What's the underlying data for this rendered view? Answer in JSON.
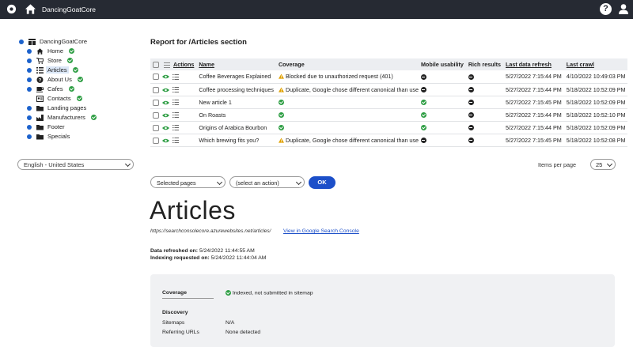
{
  "topbar": {
    "site_name": "DancingGoatCore",
    "help_label": "?"
  },
  "tree": [
    {
      "label": "DancingGoatCore",
      "icon": "site-tree-icon",
      "ok": false,
      "selected": false,
      "level": 0
    },
    {
      "label": "Home",
      "icon": "home-icon",
      "ok": true,
      "selected": false,
      "level": 1
    },
    {
      "label": "Store",
      "icon": "cart-icon",
      "ok": true,
      "selected": false,
      "level": 1
    },
    {
      "label": "Articles",
      "icon": "list-icon",
      "ok": true,
      "selected": true,
      "level": 1
    },
    {
      "label": "About Us",
      "icon": "question-icon",
      "ok": true,
      "selected": false,
      "level": 1
    },
    {
      "label": "Cafes",
      "icon": "cup-icon",
      "ok": true,
      "selected": false,
      "level": 1
    },
    {
      "label": "Contacts",
      "icon": "contacts-icon",
      "ok": true,
      "selected": false,
      "level": 1
    },
    {
      "label": "Landing pages",
      "icon": "folder-icon",
      "ok": false,
      "selected": false,
      "level": 1
    },
    {
      "label": "Manufacturers",
      "icon": "factory-icon",
      "ok": true,
      "selected": false,
      "level": 1
    },
    {
      "label": "Footer",
      "icon": "folder-icon",
      "ok": false,
      "selected": false,
      "level": 1
    },
    {
      "label": "Specials",
      "icon": "folder-icon",
      "ok": false,
      "selected": false,
      "level": 1
    }
  ],
  "language": "English - United States",
  "report": {
    "title": "Report for /Articles section",
    "headers": {
      "actions": "Actions",
      "name": "Name",
      "coverage": "Coverage",
      "mobile": "Mobile usability",
      "rich": "Rich results",
      "refresh": "Last data refresh",
      "crawl": "Last crawl"
    },
    "rows": [
      {
        "name": "Coffee Beverages Explained",
        "coverage": "Blocked due to unauthorized request (401)",
        "coverage_status": "warn",
        "mobile": "blocked",
        "rich": "blocked",
        "refresh": "5/27/2022 7:15:44 PM",
        "crawl": "4/10/2022 10:49:03 PM"
      },
      {
        "name": "Coffee processing techniques",
        "coverage": "Duplicate, Google chose different canonical than user",
        "coverage_status": "warn",
        "mobile": "blocked",
        "rich": "blocked",
        "refresh": "5/27/2022 7:15:44 PM",
        "crawl": "5/18/2022 10:52:09 PM"
      },
      {
        "name": "New article 1",
        "coverage": "",
        "coverage_status": "ok",
        "mobile": "ok",
        "rich": "blocked",
        "refresh": "5/27/2022 7:15:45 PM",
        "crawl": "5/18/2022 10:52:09 PM"
      },
      {
        "name": "On Roasts",
        "coverage": "",
        "coverage_status": "ok",
        "mobile": "ok",
        "rich": "blocked",
        "refresh": "5/27/2022 7:15:44 PM",
        "crawl": "5/18/2022 10:52:10 PM"
      },
      {
        "name": "Origins of Arabica Bourbon",
        "coverage": "",
        "coverage_status": "ok",
        "mobile": "ok",
        "rich": "blocked",
        "refresh": "5/27/2022 7:15:44 PM",
        "crawl": "5/18/2022 10:52:09 PM"
      },
      {
        "name": "Which brewing fits you?",
        "coverage": "Duplicate, Google chose different canonical than user",
        "coverage_status": "warn",
        "mobile": "blocked",
        "rich": "blocked",
        "refresh": "5/27/2022 7:15:45 PM",
        "crawl": "5/18/2022 10:52:08 PM"
      }
    ],
    "items_per_page_label": "Items per page",
    "items_per_page": "25"
  },
  "bulk": {
    "pages_select": "Selected pages",
    "action_select": "(select an action)",
    "ok_label": "OK"
  },
  "detail": {
    "title": "Articles",
    "url": "https://searchconsolecore.azurewebsites.net/articles/",
    "gsc_link": "View in Google Search Console",
    "refreshed_label": "Data refreshed on:",
    "refreshed_value": "5/24/2022 11:44:55 AM",
    "indexing_label": "Indexing requested on:",
    "indexing_value": "5/24/2022 11:44:04 AM",
    "coverage_label": "Coverage",
    "coverage_value": "Indexed, not submitted in sitemap",
    "discovery_label": "Discovery",
    "sitemaps_label": "Sitemaps",
    "sitemaps_value": "N/A",
    "referring_label": "Referring URLs",
    "referring_value": "None detected"
  },
  "colors": {
    "topbar": "#262a33",
    "accent": "#1c4fc9",
    "ok": "#2e9e44",
    "warn": "#e0a100"
  }
}
